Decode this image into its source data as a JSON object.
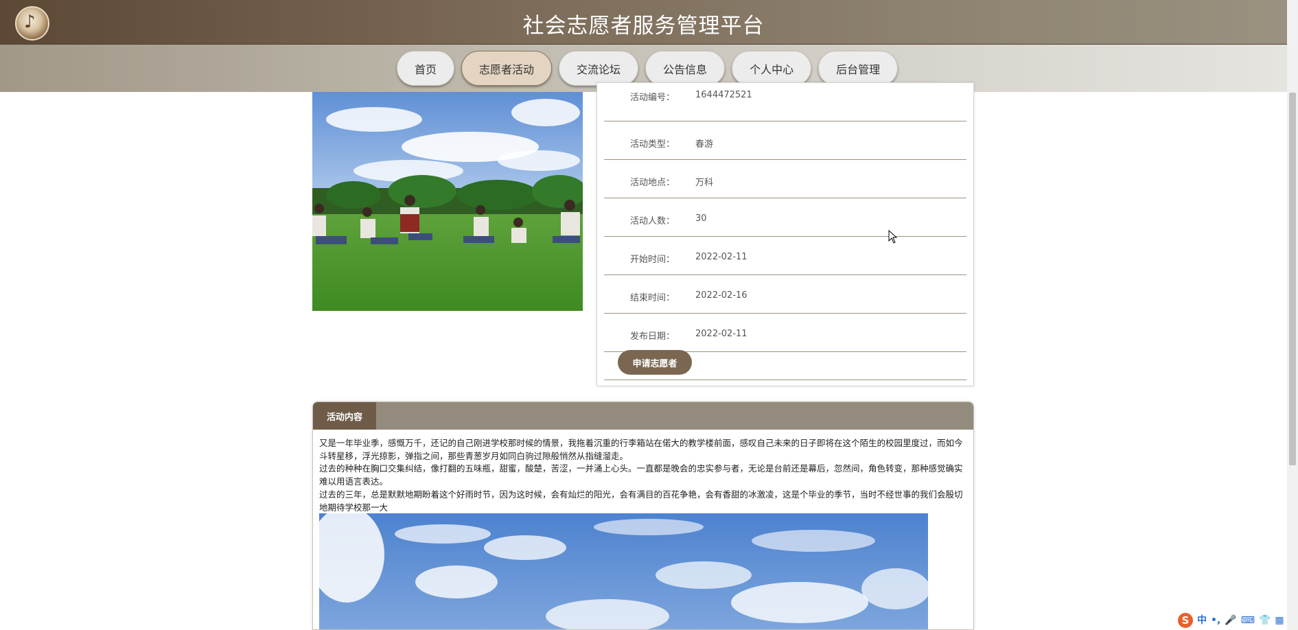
{
  "header": {
    "title": "社会志愿者服务管理平台"
  },
  "nav": {
    "items": [
      {
        "label": "首页"
      },
      {
        "label": "志愿者活动"
      },
      {
        "label": "交流论坛"
      },
      {
        "label": "公告信息"
      },
      {
        "label": "个人中心"
      },
      {
        "label": "后台管理"
      }
    ],
    "active_index": 1
  },
  "detail": {
    "rows": [
      {
        "label": "活动编号：",
        "value": "1644472521"
      },
      {
        "label": "活动类型：",
        "value": "春游"
      },
      {
        "label": "活动地点：",
        "value": "万科"
      },
      {
        "label": "活动人数：",
        "value": "30"
      },
      {
        "label": "开始时间：",
        "value": "2022-02-11"
      },
      {
        "label": "结束时间：",
        "value": "2022-02-16"
      },
      {
        "label": "发布日期：",
        "value": "2022-02-11"
      }
    ],
    "apply_label": "申请志愿者"
  },
  "content": {
    "tab_label": "活动内容",
    "paragraphs": [
      "又是一年毕业季，感慨万千，还记的自己刚进学校那时候的情景，我拖着沉重的行李箱站在偌大的教学楼前面，感叹自己未来的日子即将在这个陌生的校园里度过，而如今斗转星移，浮光掠影，弹指之间，那些青葱岁月如同白驹过隙般悄然从指缝溜走。",
      "过去的种种在胸口交集纠结，像打翻的五味瓶，甜蜜，酸楚，苦涩，一并涌上心头。一直都是晚会的忠实参与者，无论是台前还是幕后，忽然间，角色转变，那种感觉确实难以用语言表达。",
      "过去的三年，总是默默地期盼着这个好雨时节，因为这时候，会有灿烂的阳光，会有满目的百花争艳，会有香甜的冰激凌，这是个毕业的季节，当时不经世事的我们会殷切地期待学校那一大"
    ]
  },
  "ime": {
    "logo": "S",
    "lang": "中",
    "punct": "•,",
    "mic": "🎤",
    "keyboard": "⌨",
    "shirt": "👕",
    "grid": "▦"
  },
  "colors": {
    "brand_dark": "#6e5c49",
    "accent": "#7b6651",
    "nav_active": "#e4d4c2",
    "divider": "#9d937f"
  }
}
